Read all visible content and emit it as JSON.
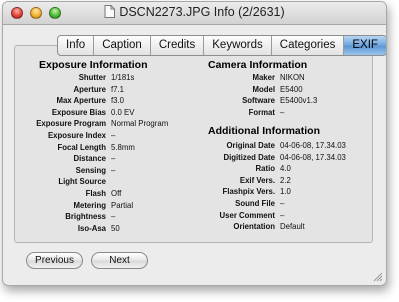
{
  "window": {
    "title": "DSCN2273.JPG Info (2/2631)"
  },
  "tabs": [
    {
      "label": "Info",
      "active": false
    },
    {
      "label": "Caption",
      "active": false
    },
    {
      "label": "Credits",
      "active": false
    },
    {
      "label": "Keywords",
      "active": false
    },
    {
      "label": "Categories",
      "active": false
    },
    {
      "label": "EXIF",
      "active": true
    }
  ],
  "exposure": {
    "title": "Exposure Information",
    "rows": [
      {
        "label": "Shutter",
        "value": "1/181s"
      },
      {
        "label": "Aperture",
        "value": "f7.1"
      },
      {
        "label": "Max Aperture",
        "value": "f3.0"
      },
      {
        "label": "Exposure Bias",
        "value": "0.0 EV"
      },
      {
        "label": "Exposure Program",
        "value": "Normal Program"
      },
      {
        "label": "Exposure Index",
        "value": "–"
      },
      {
        "label": "Focal Length",
        "value": "5.8mm"
      },
      {
        "label": "Distance",
        "value": "–"
      },
      {
        "label": "Sensing",
        "value": "–"
      },
      {
        "label": "Light Source",
        "value": ""
      },
      {
        "label": "Flash",
        "value": "Off"
      },
      {
        "label": "Metering",
        "value": "Partial"
      },
      {
        "label": "Brightness",
        "value": "–"
      },
      {
        "label": "Iso-Asa",
        "value": "50"
      }
    ]
  },
  "camera": {
    "title": "Camera Information",
    "rows": [
      {
        "label": "Maker",
        "value": "NIKON"
      },
      {
        "label": "Model",
        "value": "E5400"
      },
      {
        "label": "Software",
        "value": "E5400v1.3"
      },
      {
        "label": "Format",
        "value": "–"
      }
    ]
  },
  "additional": {
    "title": "Additional Information",
    "rows": [
      {
        "label": "Original Date",
        "value": "04-06-08, 17.34.03"
      },
      {
        "label": "Digitized Date",
        "value": "04-06-08, 17.34.03"
      },
      {
        "label": "Ratio",
        "value": "4.0"
      },
      {
        "label": "Exif Vers.",
        "value": "2.2"
      },
      {
        "label": "Flashpix Vers.",
        "value": "1.0"
      },
      {
        "label": "Sound File",
        "value": "–"
      },
      {
        "label": "User Comment",
        "value": "–"
      },
      {
        "label": "Orientation",
        "value": "Default"
      }
    ]
  },
  "buttons": {
    "previous": "Previous",
    "next": "Next"
  }
}
